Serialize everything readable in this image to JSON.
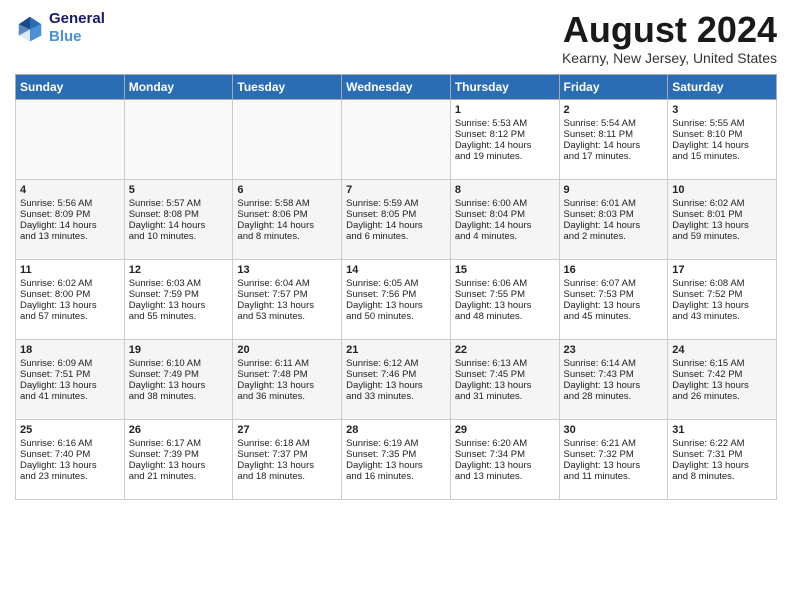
{
  "header": {
    "logo_line1": "General",
    "logo_line2": "Blue",
    "month": "August 2024",
    "location": "Kearny, New Jersey, United States"
  },
  "days_of_week": [
    "Sunday",
    "Monday",
    "Tuesday",
    "Wednesday",
    "Thursday",
    "Friday",
    "Saturday"
  ],
  "weeks": [
    [
      {
        "day": "",
        "info": ""
      },
      {
        "day": "",
        "info": ""
      },
      {
        "day": "",
        "info": ""
      },
      {
        "day": "",
        "info": ""
      },
      {
        "day": "1",
        "info": "Sunrise: 5:53 AM\nSunset: 8:12 PM\nDaylight: 14 hours\nand 19 minutes."
      },
      {
        "day": "2",
        "info": "Sunrise: 5:54 AM\nSunset: 8:11 PM\nDaylight: 14 hours\nand 17 minutes."
      },
      {
        "day": "3",
        "info": "Sunrise: 5:55 AM\nSunset: 8:10 PM\nDaylight: 14 hours\nand 15 minutes."
      }
    ],
    [
      {
        "day": "4",
        "info": "Sunrise: 5:56 AM\nSunset: 8:09 PM\nDaylight: 14 hours\nand 13 minutes."
      },
      {
        "day": "5",
        "info": "Sunrise: 5:57 AM\nSunset: 8:08 PM\nDaylight: 14 hours\nand 10 minutes."
      },
      {
        "day": "6",
        "info": "Sunrise: 5:58 AM\nSunset: 8:06 PM\nDaylight: 14 hours\nand 8 minutes."
      },
      {
        "day": "7",
        "info": "Sunrise: 5:59 AM\nSunset: 8:05 PM\nDaylight: 14 hours\nand 6 minutes."
      },
      {
        "day": "8",
        "info": "Sunrise: 6:00 AM\nSunset: 8:04 PM\nDaylight: 14 hours\nand 4 minutes."
      },
      {
        "day": "9",
        "info": "Sunrise: 6:01 AM\nSunset: 8:03 PM\nDaylight: 14 hours\nand 2 minutes."
      },
      {
        "day": "10",
        "info": "Sunrise: 6:02 AM\nSunset: 8:01 PM\nDaylight: 13 hours\nand 59 minutes."
      }
    ],
    [
      {
        "day": "11",
        "info": "Sunrise: 6:02 AM\nSunset: 8:00 PM\nDaylight: 13 hours\nand 57 minutes."
      },
      {
        "day": "12",
        "info": "Sunrise: 6:03 AM\nSunset: 7:59 PM\nDaylight: 13 hours\nand 55 minutes."
      },
      {
        "day": "13",
        "info": "Sunrise: 6:04 AM\nSunset: 7:57 PM\nDaylight: 13 hours\nand 53 minutes."
      },
      {
        "day": "14",
        "info": "Sunrise: 6:05 AM\nSunset: 7:56 PM\nDaylight: 13 hours\nand 50 minutes."
      },
      {
        "day": "15",
        "info": "Sunrise: 6:06 AM\nSunset: 7:55 PM\nDaylight: 13 hours\nand 48 minutes."
      },
      {
        "day": "16",
        "info": "Sunrise: 6:07 AM\nSunset: 7:53 PM\nDaylight: 13 hours\nand 45 minutes."
      },
      {
        "day": "17",
        "info": "Sunrise: 6:08 AM\nSunset: 7:52 PM\nDaylight: 13 hours\nand 43 minutes."
      }
    ],
    [
      {
        "day": "18",
        "info": "Sunrise: 6:09 AM\nSunset: 7:51 PM\nDaylight: 13 hours\nand 41 minutes."
      },
      {
        "day": "19",
        "info": "Sunrise: 6:10 AM\nSunset: 7:49 PM\nDaylight: 13 hours\nand 38 minutes."
      },
      {
        "day": "20",
        "info": "Sunrise: 6:11 AM\nSunset: 7:48 PM\nDaylight: 13 hours\nand 36 minutes."
      },
      {
        "day": "21",
        "info": "Sunrise: 6:12 AM\nSunset: 7:46 PM\nDaylight: 13 hours\nand 33 minutes."
      },
      {
        "day": "22",
        "info": "Sunrise: 6:13 AM\nSunset: 7:45 PM\nDaylight: 13 hours\nand 31 minutes."
      },
      {
        "day": "23",
        "info": "Sunrise: 6:14 AM\nSunset: 7:43 PM\nDaylight: 13 hours\nand 28 minutes."
      },
      {
        "day": "24",
        "info": "Sunrise: 6:15 AM\nSunset: 7:42 PM\nDaylight: 13 hours\nand 26 minutes."
      }
    ],
    [
      {
        "day": "25",
        "info": "Sunrise: 6:16 AM\nSunset: 7:40 PM\nDaylight: 13 hours\nand 23 minutes."
      },
      {
        "day": "26",
        "info": "Sunrise: 6:17 AM\nSunset: 7:39 PM\nDaylight: 13 hours\nand 21 minutes."
      },
      {
        "day": "27",
        "info": "Sunrise: 6:18 AM\nSunset: 7:37 PM\nDaylight: 13 hours\nand 18 minutes."
      },
      {
        "day": "28",
        "info": "Sunrise: 6:19 AM\nSunset: 7:35 PM\nDaylight: 13 hours\nand 16 minutes."
      },
      {
        "day": "29",
        "info": "Sunrise: 6:20 AM\nSunset: 7:34 PM\nDaylight: 13 hours\nand 13 minutes."
      },
      {
        "day": "30",
        "info": "Sunrise: 6:21 AM\nSunset: 7:32 PM\nDaylight: 13 hours\nand 11 minutes."
      },
      {
        "day": "31",
        "info": "Sunrise: 6:22 AM\nSunset: 7:31 PM\nDaylight: 13 hours\nand 8 minutes."
      }
    ]
  ]
}
